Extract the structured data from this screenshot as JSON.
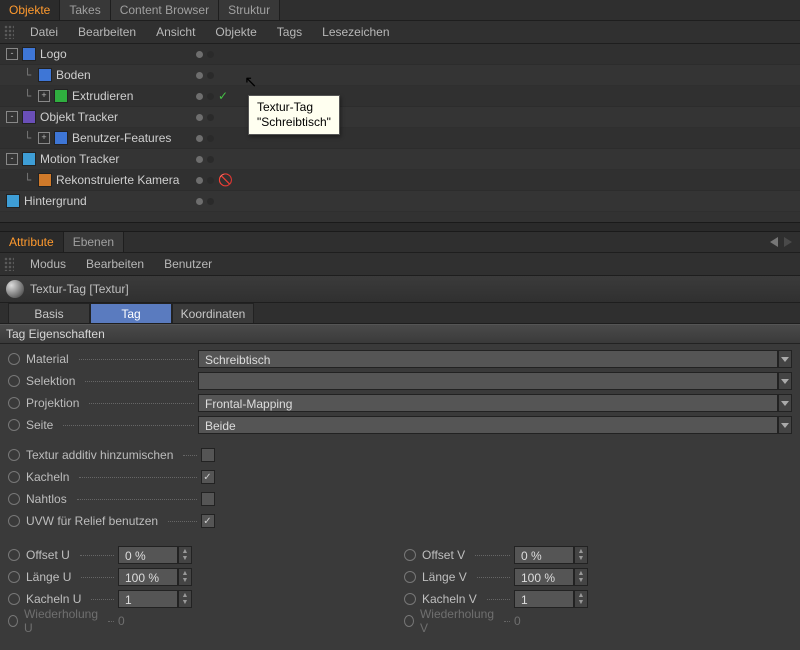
{
  "top_tabs": [
    "Objekte",
    "Takes",
    "Content Browser",
    "Struktur"
  ],
  "top_tabs_active": 0,
  "om_menu": [
    "Datei",
    "Bearbeiten",
    "Ansicht",
    "Objekte",
    "Tags",
    "Lesezeichen"
  ],
  "tree": [
    {
      "label": "Logo",
      "depth": 0,
      "expander": "-",
      "icon": "ic-grid"
    },
    {
      "label": "Boden",
      "depth": 1,
      "expander": "",
      "icon": "ic-grid"
    },
    {
      "label": "Extrudieren",
      "depth": 1,
      "expander": "+",
      "icon": "ic-green",
      "check": true
    },
    {
      "label": "Objekt Tracker",
      "depth": 0,
      "expander": "-",
      "icon": "ic-purple"
    },
    {
      "label": "Benutzer-Features",
      "depth": 1,
      "expander": "+",
      "icon": "ic-grid"
    },
    {
      "label": "Motion Tracker",
      "depth": 0,
      "expander": "-",
      "icon": "ic-cyan"
    },
    {
      "label": "Rekonstruierte Kamera",
      "depth": 1,
      "expander": "",
      "icon": "ic-orange",
      "ban": true
    },
    {
      "label": "Hintergrund",
      "depth": 0,
      "expander": "",
      "icon": "ic-cyan"
    }
  ],
  "tooltip": {
    "line1": "Textur-Tag",
    "line2": "\"Schreibtisch\""
  },
  "am_tabs": [
    "Attribute",
    "Ebenen"
  ],
  "am_tabs_active": 0,
  "am_menu": [
    "Modus",
    "Bearbeiten",
    "Benutzer"
  ],
  "am_title": "Textur-Tag [Textur]",
  "am_subtabs": [
    "Basis",
    "Tag",
    "Koordinaten"
  ],
  "am_subtabs_active": 1,
  "section_title": "Tag Eigenschaften",
  "props_top": {
    "material_label": "Material",
    "material_value": "Schreibtisch",
    "selection_label": "Selektion",
    "selection_value": "",
    "projection_label": "Projektion",
    "projection_value": "Frontal-Mapping",
    "side_label": "Seite",
    "side_value": "Beide"
  },
  "props_check": {
    "additive": "Textur additiv hinzumischen",
    "tile": "Kacheln",
    "seamless": "Nahtlos",
    "uvw": "UVW für Relief benutzen"
  },
  "pairs": {
    "offset_u": {
      "label": "Offset U",
      "value": "0 %"
    },
    "offset_v": {
      "label": "Offset V",
      "value": "0 %"
    },
    "len_u": {
      "label": "Länge U",
      "value": "100 %"
    },
    "len_v": {
      "label": "Länge V",
      "value": "100 %"
    },
    "tile_u": {
      "label": "Kacheln U",
      "value": "1"
    },
    "tile_v": {
      "label": "Kacheln V",
      "value": "1"
    },
    "rep_u": {
      "label": "Wiederholung U",
      "value": "0"
    },
    "rep_v": {
      "label": "Wiederholung V",
      "value": "0"
    }
  }
}
